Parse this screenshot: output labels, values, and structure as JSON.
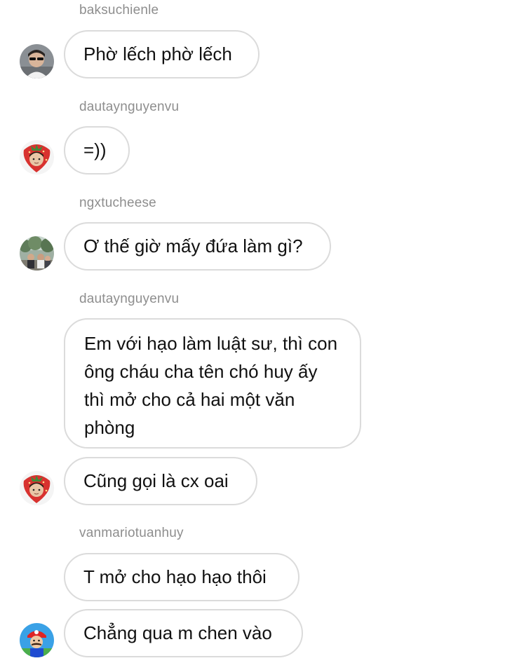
{
  "thread": {
    "groups": [
      {
        "sender": "baksuchienle",
        "avatar_icon": "user-avatar-sunglasses-icon",
        "messages": [
          "Phờ lếch phờ lếch"
        ]
      },
      {
        "sender": "dautaynguyenvu",
        "avatar_icon": "user-avatar-strawberry-icon",
        "messages": [
          "=))"
        ]
      },
      {
        "sender": "ngxtucheese",
        "avatar_icon": "user-avatar-group-photo-icon",
        "messages": [
          "Ơ thế giờ mấy đứa làm gì?"
        ]
      },
      {
        "sender": "dautaynguyenvu",
        "avatar_icon": "user-avatar-strawberry-icon",
        "messages": [
          "Em với hạo làm luật sư, thì con ông cháu cha tên chó huy ấy thì mở cho cả hai một văn phòng",
          "Cũng gọi là cx oai"
        ]
      },
      {
        "sender": "vanmariotuanhuy",
        "avatar_icon": "user-avatar-mario-icon",
        "messages": [
          "T mở cho hạo hạo thôi",
          "Chẳng qua m chen vào"
        ]
      }
    ]
  },
  "colors": {
    "bubble_border": "#dbdbdb",
    "sender_text": "#8e8e8e",
    "message_text": "#111111",
    "background": "#ffffff"
  }
}
